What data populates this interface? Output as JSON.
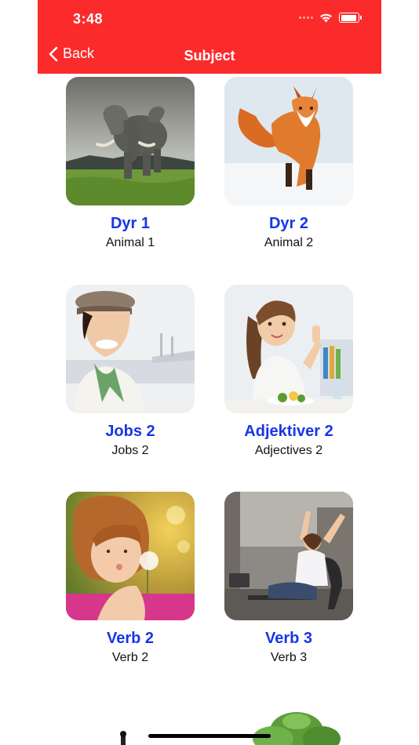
{
  "status_bar": {
    "time": "3:48"
  },
  "nav": {
    "back_label": "Back",
    "title": "Subject"
  },
  "colors": {
    "nav_bg": "#fb2b2b",
    "title_blue": "#1735e8"
  },
  "cards": [
    {
      "title": "Dyr 1",
      "subtitle": "Animal 1",
      "image": "elephant"
    },
    {
      "title": "Dyr 2",
      "subtitle": "Animal 2",
      "image": "fox"
    },
    {
      "title": "Jobs 2",
      "subtitle": "Jobs 2",
      "image": "flight-attendant"
    },
    {
      "title": "Adjektiver 2",
      "subtitle": "Adjectives 2",
      "image": "girl-thumbs-up"
    },
    {
      "title": "Verb 2",
      "subtitle": "Verb 2",
      "image": "girl-dandelion"
    },
    {
      "title": "Verb 3",
      "subtitle": "Verb 3",
      "image": "woman-stretching"
    }
  ]
}
